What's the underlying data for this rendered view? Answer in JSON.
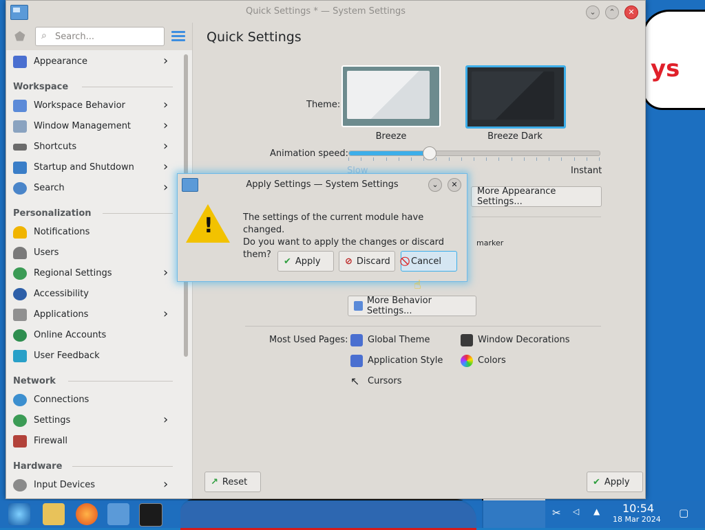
{
  "window": {
    "title": "Quick Settings * — System Settings"
  },
  "sidebar": {
    "search_placeholder": "Search...",
    "items": [
      {
        "label": "Appearance",
        "chevron": true
      },
      {
        "label": "Workspace Behavior",
        "chevron": true
      },
      {
        "label": "Window Management",
        "chevron": true
      },
      {
        "label": "Shortcuts",
        "chevron": true
      },
      {
        "label": "Startup and Shutdown",
        "chevron": true
      },
      {
        "label": "Search",
        "chevron": true
      },
      {
        "label": "Notifications",
        "chevron": false
      },
      {
        "label": "Users",
        "chevron": false
      },
      {
        "label": "Regional Settings",
        "chevron": true
      },
      {
        "label": "Accessibility",
        "chevron": false
      },
      {
        "label": "Applications",
        "chevron": true
      },
      {
        "label": "Online Accounts",
        "chevron": false
      },
      {
        "label": "User Feedback",
        "chevron": false
      },
      {
        "label": "Connections",
        "chevron": false
      },
      {
        "label": "Settings",
        "chevron": true
      },
      {
        "label": "Firewall",
        "chevron": false
      },
      {
        "label": "Input Devices",
        "chevron": true
      }
    ],
    "sections": {
      "workspace": "Workspace",
      "personalization": "Personalization",
      "network": "Network",
      "hardware": "Hardware"
    }
  },
  "main": {
    "title": "Quick Settings",
    "theme_label": "Theme:",
    "themes": [
      {
        "name": "Breeze",
        "selected": false
      },
      {
        "name": "Breeze Dark",
        "selected": true
      }
    ],
    "animation_label": "Animation speed:",
    "animation_value": 0.32,
    "slow_label": "Slow",
    "instant_label": "Instant",
    "more_appearance": "More Appearance Settings...",
    "marker_text": "marker",
    "more_behavior": "More Behavior Settings...",
    "most_used_label": "Most Used Pages:",
    "most_used": [
      "Global Theme",
      "Window Decorations",
      "Application Style",
      "Colors",
      "Cursors"
    ],
    "reset": "Reset",
    "apply": "Apply"
  },
  "dialog": {
    "title": "Apply Settings — System Settings",
    "message_line1": "The settings of the current module have changed.",
    "message_line2": "Do you want to apply the changes or discard them?",
    "apply": "Apply",
    "discard": "Discard",
    "cancel": "Cancel"
  },
  "desktop": {
    "sticker_text": "ys"
  },
  "taskbar": {
    "time": "10:54",
    "date": "18 Mar 2024"
  },
  "colors": {
    "accent": "#3daee9",
    "warning": "#f2c200"
  }
}
